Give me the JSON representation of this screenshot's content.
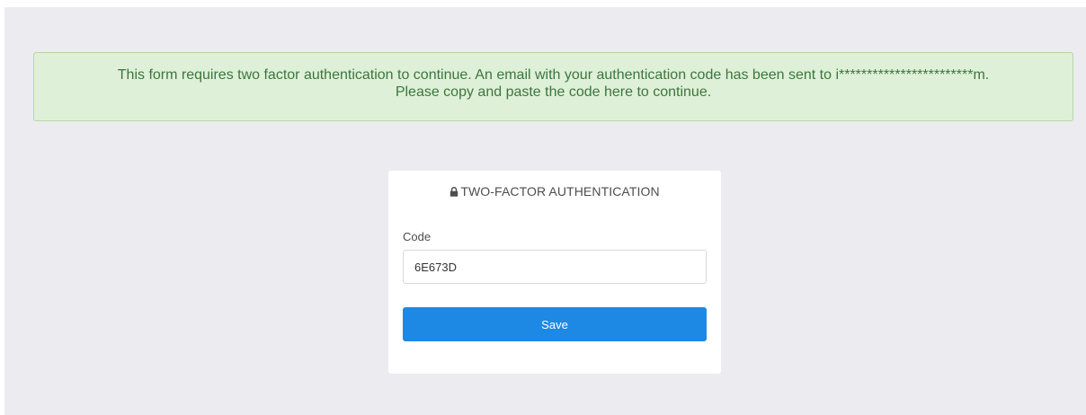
{
  "alert": {
    "line1": "This form requires two factor authentication to continue. An email with your authentication code has been sent to i************************m.",
    "line2": "Please copy and paste the code here to continue."
  },
  "card": {
    "title": "TWO-FACTOR AUTHENTICATION",
    "title_icon": "lock-icon",
    "code_label": "Code",
    "code_value": "6E673D",
    "save_label": "Save"
  },
  "colors": {
    "page_bg": "#ececf0",
    "alert_bg": "#dff0d8",
    "alert_text": "#3c763d",
    "button_bg": "#1e88e5"
  }
}
